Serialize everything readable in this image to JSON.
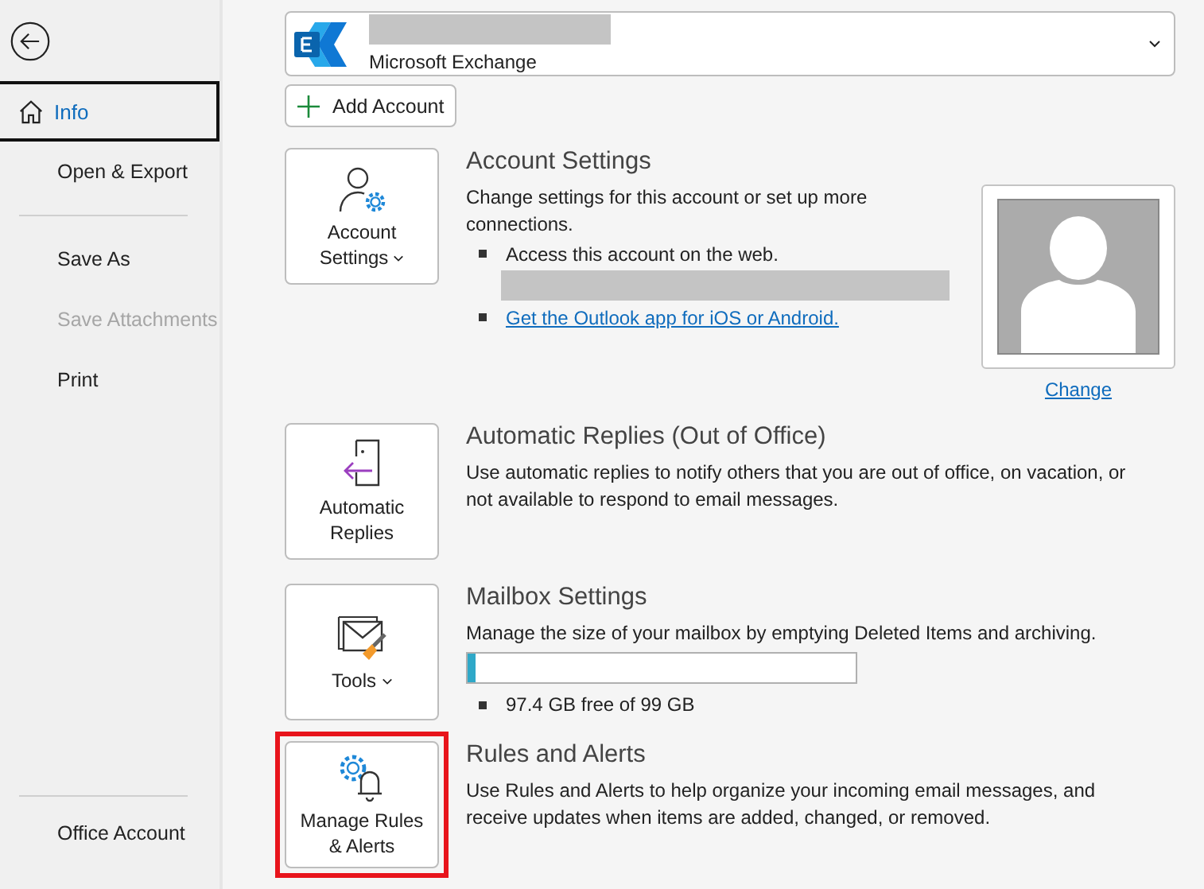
{
  "sidebar": {
    "items": [
      {
        "label": "Info",
        "selected": true,
        "disabled": false
      },
      {
        "label": "Open & Export",
        "selected": false,
        "disabled": false
      },
      {
        "kind": "divider"
      },
      {
        "label": "Save As",
        "selected": false,
        "disabled": false
      },
      {
        "label": "Save Attachments",
        "selected": false,
        "disabled": true
      },
      {
        "label": "Print",
        "selected": false,
        "disabled": false
      }
    ],
    "footer": [
      {
        "label": "Office Account",
        "selected": false,
        "disabled": false
      }
    ]
  },
  "account_selector": {
    "account_type": "Microsoft Exchange"
  },
  "add_account_button": {
    "label": "Add Account"
  },
  "sections": [
    {
      "kind": "account",
      "button": {
        "label": "Account Settings",
        "dropdown": true,
        "highlighted": false
      },
      "title": "Account Settings",
      "description": "Change settings for this account or set up more connections.",
      "bullets": [
        {
          "kind": "text",
          "text": "Access this account on the web."
        },
        {
          "kind": "redacted"
        },
        {
          "kind": "link",
          "text": "Get the Outlook app for iOS or Android."
        }
      ],
      "profile": {
        "change_link": "Change"
      }
    },
    {
      "kind": "auto",
      "button": {
        "label": "Automatic Replies",
        "dropdown": false,
        "highlighted": false
      },
      "title": "Automatic Replies (Out of Office)",
      "description": "Use automatic replies to notify others that you are out of office, on vacation, or not available to respond to email messages."
    },
    {
      "kind": "mailbox",
      "button": {
        "label": "Tools",
        "dropdown": true,
        "highlighted": false
      },
      "title": "Mailbox Settings",
      "description": "Manage the size of your mailbox by emptying Deleted Items and archiving.",
      "storage": {
        "level": 0.02,
        "text": "97.4 GB free of 99 GB"
      }
    },
    {
      "kind": "rules",
      "button": {
        "label": "Manage Rules & Alerts",
        "dropdown": false,
        "highlighted": true
      },
      "title": "Rules and Alerts",
      "description": "Use Rules and Alerts to help organize your incoming email messages, and receive updates when items are added, changed, or removed."
    }
  ]
}
